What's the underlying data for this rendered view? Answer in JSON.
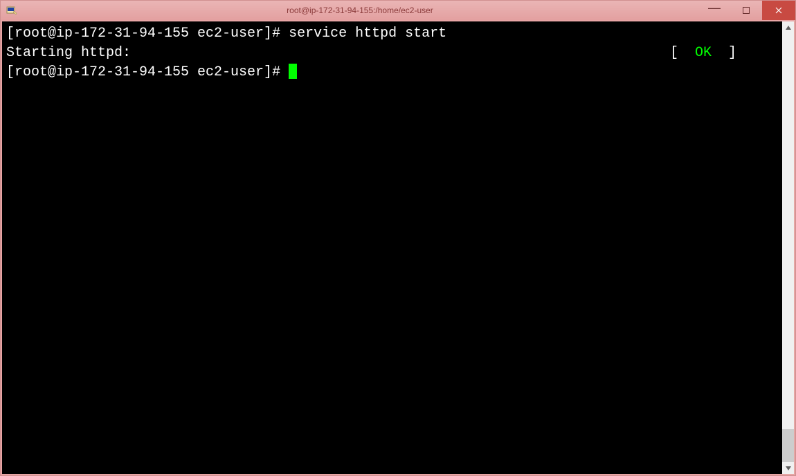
{
  "titlebar": {
    "title": "root@ip-172-31-94-155:/home/ec2-user"
  },
  "terminal": {
    "line1_prompt": "[root@ip-172-31-94-155 ec2-user]# ",
    "line1_command": "service httpd start",
    "line2_left": "Starting httpd:",
    "line2_bracket_open": "[",
    "line2_status": "  OK  ",
    "line2_bracket_close": "]",
    "line3_prompt": "[root@ip-172-31-94-155 ec2-user]# "
  }
}
